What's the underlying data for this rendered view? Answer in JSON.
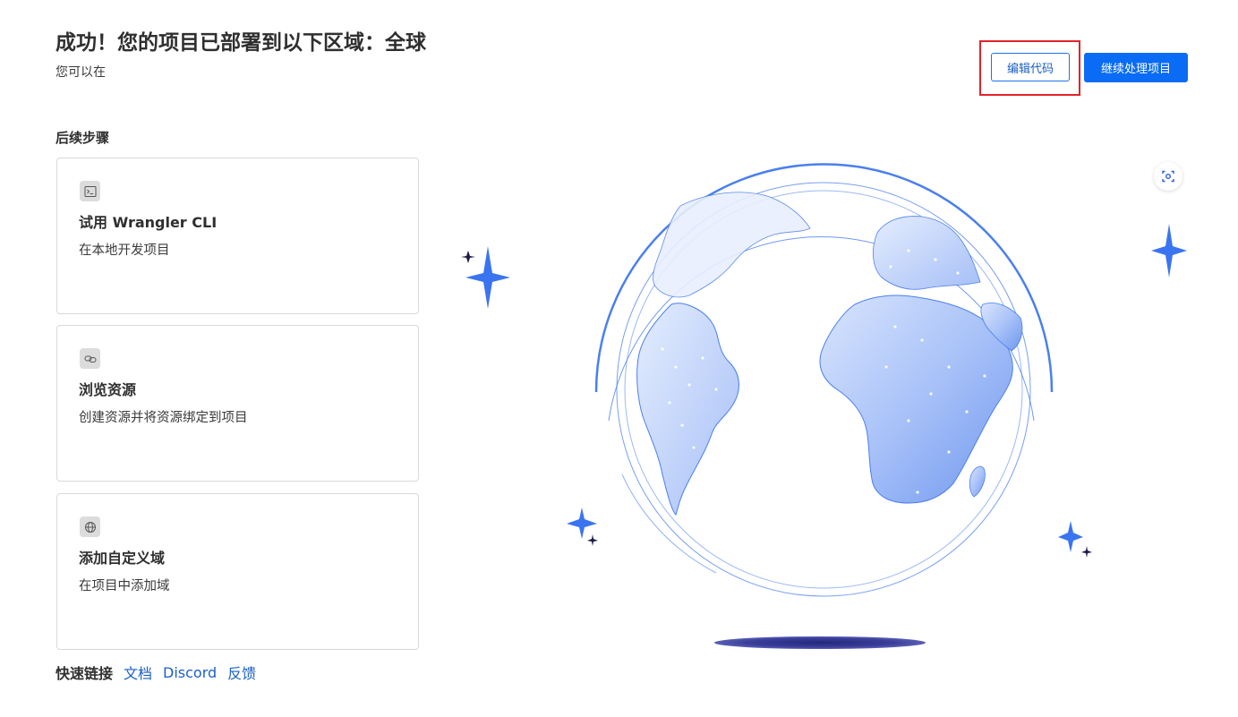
{
  "header": {
    "title": "成功！您的项目已部署到以下区域：全球",
    "subtitle": "您可以在"
  },
  "actions": {
    "edit_code_label": "编辑代码",
    "continue_label": "继续处理项目"
  },
  "next_steps": {
    "title": "后续步骤",
    "cards": [
      {
        "icon": "terminal-icon",
        "title": "试用 Wrangler CLI",
        "description": "在本地开发项目"
      },
      {
        "icon": "link-icon",
        "title": "浏览资源",
        "description": "创建资源并将资源绑定到项目"
      },
      {
        "icon": "globe-icon",
        "title": "添加自定义域",
        "description": "在项目中添加域"
      }
    ]
  },
  "quick_links": {
    "label": "快速链接",
    "links": [
      "文档",
      "Discord",
      "反馈"
    ]
  },
  "colors": {
    "primary": "#0a6cf5",
    "highlight_border": "#e2232a",
    "globe_blue": "#4a7ff0",
    "globe_light": "#cfdefc",
    "star_blue": "#3b74f0",
    "star_dark": "#1c1a4a"
  },
  "illustration": {
    "icon": "globe-illustration",
    "scan_icon": "scan-icon"
  }
}
